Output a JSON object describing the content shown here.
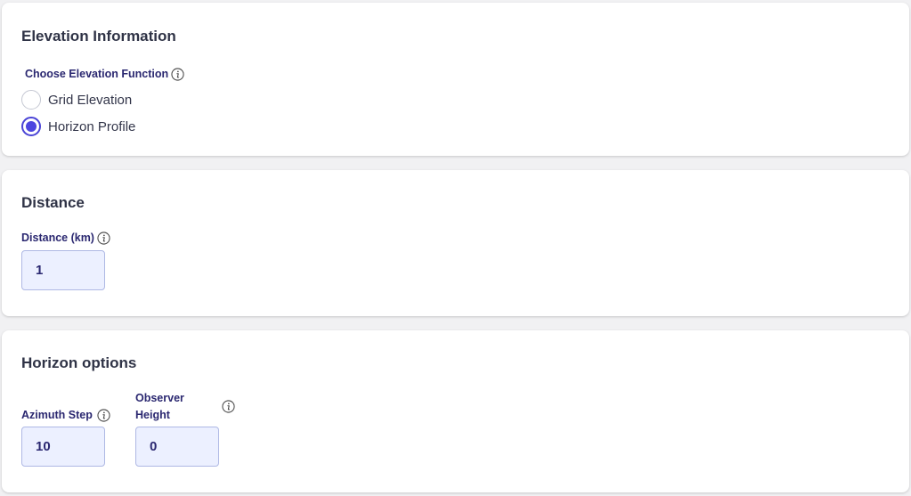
{
  "elevation": {
    "title": "Elevation Information",
    "function_label": "Choose Elevation Function",
    "options": [
      {
        "label": "Grid Elevation",
        "checked": false
      },
      {
        "label": "Horizon Profile",
        "checked": true
      }
    ]
  },
  "distance": {
    "title": "Distance",
    "field_label": "Distance (km)",
    "value": "1"
  },
  "horizon": {
    "title": "Horizon options",
    "azimuth_label": "Azimuth Step",
    "azimuth_value": "10",
    "observer_label_line1": "Observer",
    "observer_label_line2": "Height",
    "observer_value": "0"
  },
  "colors": {
    "accent": "#4d46e0",
    "label": "#2a2770",
    "input_bg": "#ecf0ff",
    "input_border": "#aeb8e4"
  },
  "icons": [
    "info-icon"
  ]
}
